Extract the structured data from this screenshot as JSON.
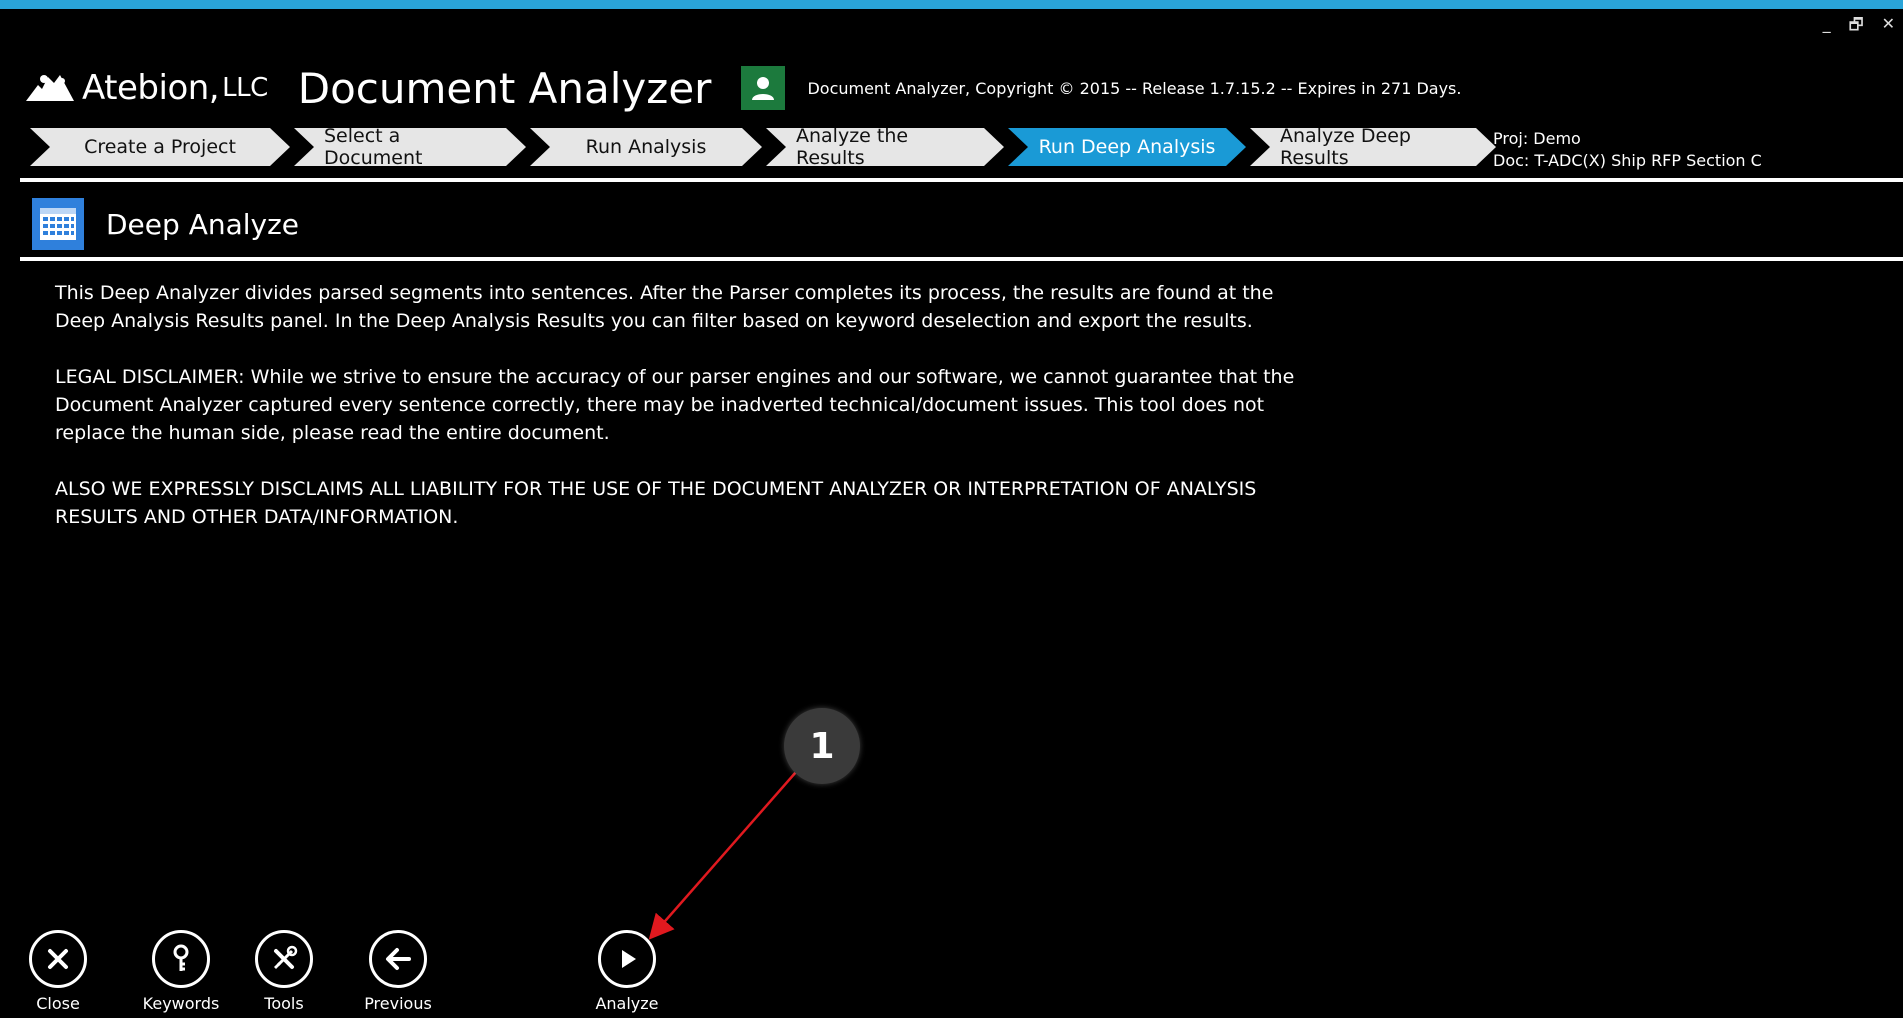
{
  "window": {
    "minimize": "_",
    "restore": "🗗",
    "close": "✕"
  },
  "header": {
    "logo_text": "Atebion,",
    "logo_suffix": "LLC",
    "app_title": "Document Analyzer",
    "copyright": "Document Analyzer, Copyright © 2015 -- Release 1.7.15.2 -- Expires in 271 Days."
  },
  "wizard": {
    "steps": [
      {
        "label": "Create a Project"
      },
      {
        "label": "Select a Document"
      },
      {
        "label": "Run Analysis"
      },
      {
        "label": "Analyze the Results"
      },
      {
        "label": "Run Deep Analysis"
      },
      {
        "label": "Analyze Deep Results"
      }
    ],
    "active_index": 4
  },
  "project_info": {
    "proj": "Proj: Demo",
    "doc": "Doc: T-ADC(X) Ship RFP Section C"
  },
  "panel": {
    "title": "Deep Analyze",
    "paragraphs": [
      "This Deep Analyzer divides parsed segments into sentences. After the Parser completes its process, the results are found at the Deep Analysis Results panel. In the Deep Analysis Results you can filter based on keyword deselection and export the results.",
      "LEGAL DISCLAIMER: While we strive to ensure the accuracy of our parser engines and our software, we cannot guarantee that the Document Analyzer captured every sentence correctly, there may be inadverted technical/document issues. This tool does not replace the human side, please read the entire document.",
      "ALSO WE EXPRESSLY DISCLAIMS ALL LIABILITY FOR THE USE OF THE DOCUMENT ANALYZER OR INTERPRETATION OF ANALYSIS RESULTS AND OTHER DATA/INFORMATION."
    ]
  },
  "callout": {
    "number": "1"
  },
  "toolbar": {
    "close": "Close",
    "keywords": "Keywords",
    "tools": "Tools",
    "previous": "Previous",
    "analyze": "Analyze"
  },
  "colors": {
    "accent": "#1a9ad6",
    "top_line": "#2aa4d8",
    "user_icon_bg": "#1c7a3d",
    "grid_icon_bg": "#2f80dc",
    "arrow": "#e0191f"
  }
}
